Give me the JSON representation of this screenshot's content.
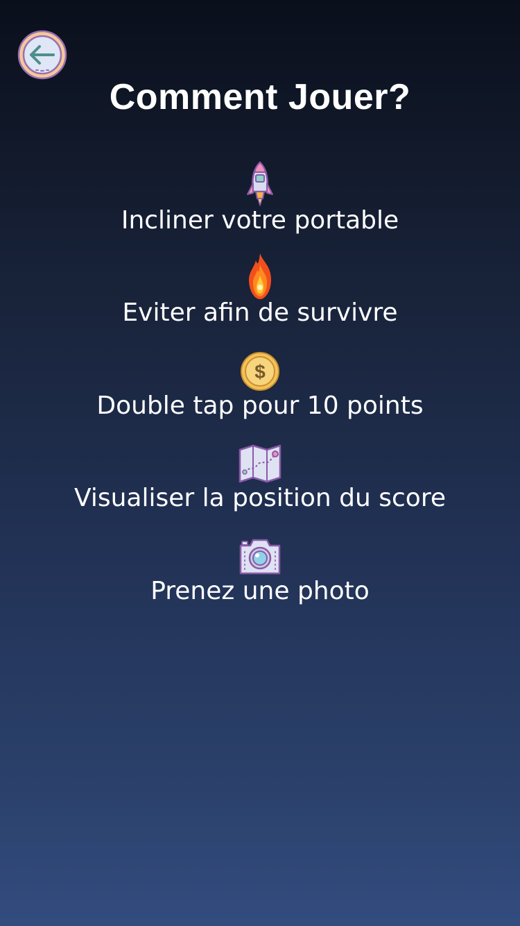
{
  "header": {
    "back_icon": "back-arrow-icon",
    "title": "Comment Jouer?"
  },
  "steps": [
    {
      "icon": "rocket-icon",
      "label": "Incliner votre portable"
    },
    {
      "icon": "fire-icon",
      "label": "Eviter afin de survivre"
    },
    {
      "icon": "coin-icon",
      "label": "Double tap pour 10 points"
    },
    {
      "icon": "map-icon",
      "label": "Visualiser la position du score"
    },
    {
      "icon": "camera-icon",
      "label": "Prenez une photo"
    }
  ],
  "colors": {
    "background_top": "#0a0f1b",
    "background_bottom": "#334c7f",
    "text": "#ffffff",
    "icon_outline": "#8a5aa8"
  }
}
